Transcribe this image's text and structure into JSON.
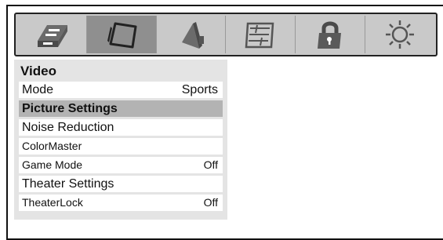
{
  "toolbar": {
    "icons": [
      "setup-icon",
      "picture-icon",
      "sound-icon",
      "preferences-icon",
      "lock-icon",
      "settings-icon"
    ],
    "active_index": 1
  },
  "menu": {
    "title": "Video",
    "items": [
      {
        "label": "Mode",
        "value": "Sports"
      },
      {
        "label": "Picture Settings",
        "value": ""
      },
      {
        "label": "Noise Reduction",
        "value": ""
      },
      {
        "label": "ColorMaster",
        "value": ""
      },
      {
        "label": "Game Mode",
        "value": "Off"
      },
      {
        "label": "Theater Settings",
        "value": ""
      },
      {
        "label": "TheaterLock",
        "value": "Off"
      }
    ]
  },
  "colors": {
    "bar_bg": "#c9c9c9",
    "active_tab": "#8f8f8f",
    "menu_bg": "#e4e4e4",
    "selected_row": "#b3b3b3"
  }
}
